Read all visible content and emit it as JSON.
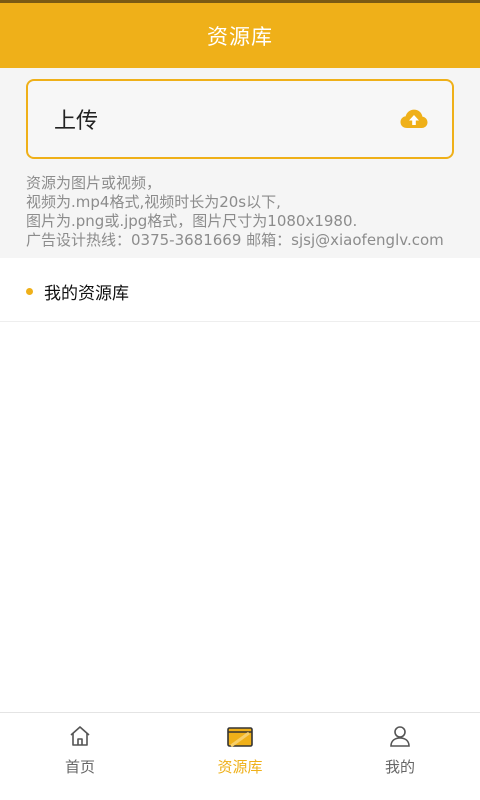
{
  "header": {
    "title": "资源库"
  },
  "upload": {
    "label": "上传",
    "icon": "cloud-upload-icon",
    "note_lines": [
      "资源为图片或视频，",
      "视频为.mp4格式,视频时长为20s以下,",
      "图片为.png或.jpg格式，图片尺寸为1080x1980.",
      "广告设计热线：0375-3681669  邮箱：sjsj@xiaofenglv.com"
    ]
  },
  "library": {
    "title": "我的资源库"
  },
  "tabs": [
    {
      "label": "首页",
      "icon": "home-icon",
      "active": false
    },
    {
      "label": "资源库",
      "icon": "folder-icon",
      "active": true
    },
    {
      "label": "我的",
      "icon": "user-icon",
      "active": false
    }
  ],
  "colors": {
    "accent": "#efb019",
    "header_border": "#7a5a14",
    "note_text": "#8c8c8c",
    "background": "#f5f5f5"
  }
}
